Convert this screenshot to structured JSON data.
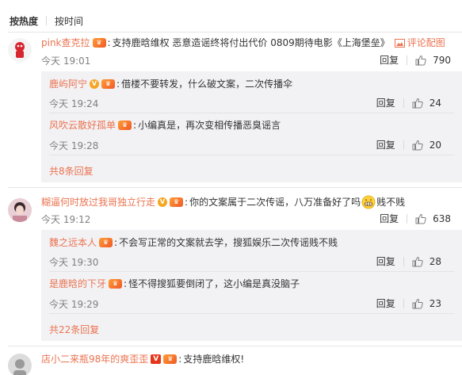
{
  "tabs": {
    "hot": "按热度",
    "time": "按时间"
  },
  "reply_label": "回复",
  "comments": [
    {
      "user": "pink查克拉",
      "text": "支持鹿晗维权 恶意造谣终将付出代价 0809期待电影《上海堡垒》",
      "pic_link": "评论配图",
      "time": "今天 19:01",
      "likes": "790",
      "replies": [
        {
          "user": "鹿屿阿宁",
          "text": "借楼不要转发，什么破文案，二次传播伞",
          "time": "今天 19:24",
          "likes": "24"
        },
        {
          "user": "风吹云散好孤单",
          "text": "小编真是，再次变相传播恶臭谣言",
          "time": "今天 19:28",
          "likes": "20"
        }
      ],
      "more": "共8条回复"
    },
    {
      "user": "糊逼何时放过我哥独立行走",
      "text_before": "你的文案属于二次传谣，八万准备好了吗",
      "text_after": "贱不贱",
      "time": "今天 19:12",
      "likes": "638",
      "replies": [
        {
          "user": "魏之远本人",
          "text": "不会写正常的文案就去学，搜狐娱乐二次传谣贱不贱",
          "time": "今天 19:30",
          "likes": "28"
        },
        {
          "user": "是鹿晗的下牙",
          "text": "怪不得搜狐要倒闭了，这小编是真没脑子",
          "time": "今天 19:29",
          "likes": "23"
        }
      ],
      "more": "共22条回复"
    },
    {
      "user": "店小二来瓶98年的爽歪歪",
      "text": "支持鹿晗维权!"
    }
  ],
  "colors": {
    "accent": "#eb7350",
    "reply_bg": "#f2f2f5",
    "meta": "#808080"
  },
  "icons": {
    "like": "thumb-up-icon",
    "pic": "image-icon",
    "vip": "crown-icon",
    "emoji": "grin-emoji-icon"
  }
}
